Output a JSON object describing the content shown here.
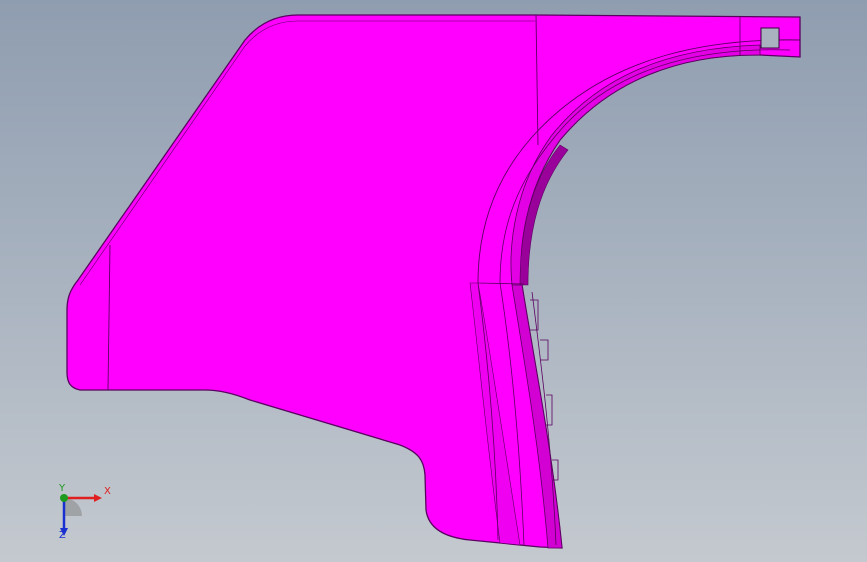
{
  "viewport": {
    "background_top": "#8f9db0",
    "background_bottom": "#c4c9cf"
  },
  "model": {
    "face_color": "#ff00ff",
    "edge_color": "#5a0060",
    "shade_color": "#c800c8"
  },
  "triad": {
    "x_label": "X",
    "y_label": "Y",
    "z_label": "Z",
    "x_color": "#e02020",
    "y_color": "#1e9a1e",
    "z_color": "#1a2fd0"
  }
}
